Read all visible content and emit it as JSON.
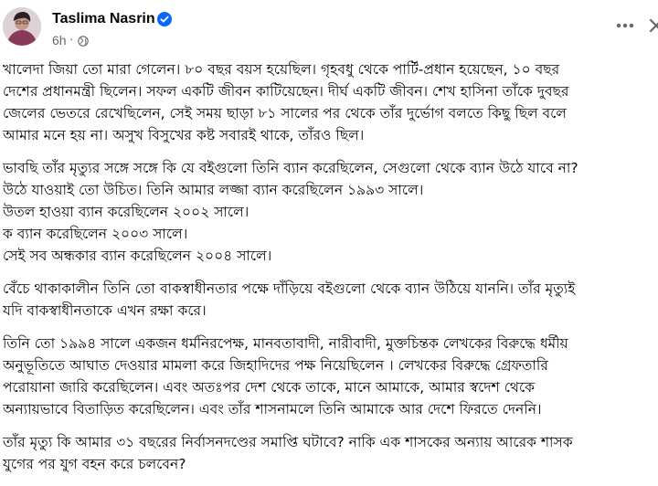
{
  "post": {
    "author": "Taslima Nasrin",
    "time": "6h",
    "dot": "·",
    "icons": {
      "verified": "verified-badge-icon",
      "privacy": "globe-icon",
      "more": "more-options-icon",
      "close": "close-icon"
    },
    "colors": {
      "verified": "#0866ff",
      "meta_text": "#65676b",
      "body_text": "#050505"
    },
    "paragraphs": [
      {
        "lines": [
          "খালেদা জিয়া তো মারা গেলেন। ৮০ বছর বয়স হয়েছিল।  গৃহবধু থেকে পার্টি-প্রধান হয়েছেন, ১০ বছর",
          "দেশের প্রধানমন্ত্রী ছিলেন। সফল একটি জীবন কাটিয়েছেন। দীর্ঘ একটি জীবন। শেখ হাসিনা তাঁকে দুবছর",
          "জেলের ভেতরে রেখেছিলেন, সেই সময়  ছাড়া ৮১ সালের পর থেকে তাঁর দুর্ভোগ বলতে কিছু ছিল বলে",
          "আমার মনে হয় না। অসুখ বিসুখের কষ্ট সবারই থাকে, তাঁরও ছিল।"
        ]
      },
      {
        "lines": [
          "ভাবছি তাঁর মৃত্যুর সঙ্গে সঙ্গে কি যে বইগুলো তিনি ব্যান করেছিলেন, সেগুলো থেকে ব্যান  উঠে যাবে না?",
          "উঠে যাওয়াই তো উচিত। তিনি আমার  লজ্জা ব্যান করেছিলেন ১৯৯৩ সালে।",
          "উতল হাওয়া ব্যান করেছিলেন ২০০২ সালে।",
          "ক ব্যান করেছিলেন ২০০৩ সালে।",
          "সেই সব অন্ধকার ব্যান করেছিলেন ২০০৪ সালে।"
        ]
      },
      {
        "lines": [
          "বেঁচে থাকাকালীন তিনি তো বাকস্বাধীনতার পক্ষে দাঁড়িয়ে বইগুলো  থেকে ব্যান উঠিয়ে যাননি। তাঁর মৃত্যুই",
          "যদি বাকস্বাধীনতাকে এখন রক্ষা করে।"
        ]
      },
      {
        "lines": [
          "তিনি তো ১৯৯৪ সালে একজন ধর্মনিরপেক্ষ, মানবতাবাদী, নারীবাদী,  মুক্তচিন্তক লেখকের বিরুদ্ধে ধর্মীয়",
          "অনুভূতিতে আঘাত দেওয়ার মামলা করে জিহাদিদের পক্ষ নিয়েছিলেন । লেখকের বিরুদ্ধে গ্রেফতারি",
          "পরোয়ানা জারি করেছিলেন। এবং অতঃপর দেশ থেকে তাকে, মানে আমাকে, আমার স্বদেশ থেকে",
          "অন্যায়ভাবে বিতাড়িত করেছিলেন। এবং তাঁর শাসনামলে তিনি আমাকে আর দেশে ফিরতে দেননি।"
        ]
      },
      {
        "lines": [
          "তাঁর মৃত্যু কি আমার ৩১ বছরের নির্বাসনদণ্ডের সমাপ্তি ঘটাবে? নাকি  এক শাসকের অন্যায় আরেক শাসক",
          "যুগের পর যুগ বহন করে চলবেন?"
        ]
      }
    ]
  }
}
